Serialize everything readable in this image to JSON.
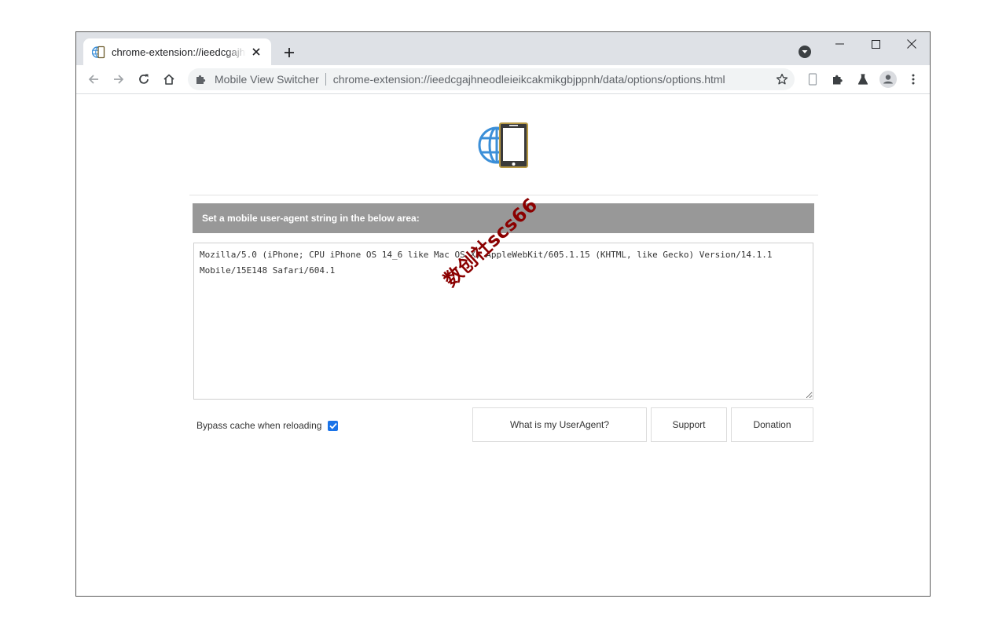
{
  "tab": {
    "title": "chrome-extension://ieedcgajhneodleieikcakmikgbjppnh/data/options/options.html"
  },
  "omnibox": {
    "site_name": "Mobile View Switcher",
    "url": "chrome-extension://ieedcgajhneodleieikcakmikgbjppnh/data/options/options.html"
  },
  "page": {
    "heading": "Set a mobile user-agent string in the below area:",
    "user_agent_value": "Mozilla/5.0 (iPhone; CPU iPhone OS 14_6 like Mac OS X) AppleWebKit/605.1.15 (KHTML, like Gecko) Version/14.1.1 Mobile/15E148 Safari/604.1",
    "watermark": "数创社scs66",
    "bypass_cache_label": "Bypass cache when reloading",
    "bypass_cache_checked": true,
    "buttons": {
      "what_is_ua": "What is my UserAgent?",
      "support": "Support",
      "donation": "Donation"
    }
  },
  "colors": {
    "tabstrip_bg": "#dee1e6",
    "heading_bg": "#989898",
    "checkbox_accent": "#1a73e8",
    "logo_globe": "#3b8fd8",
    "logo_phone": "#b89a45",
    "watermark": "#8b0000"
  }
}
